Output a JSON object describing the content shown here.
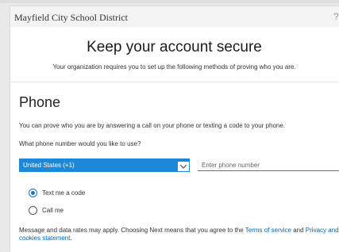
{
  "header": {
    "org_name": "Mayfield City School District",
    "help": "?"
  },
  "page": {
    "title": "Keep your account secure",
    "subtitle": "Your organization requires you to set up the following methods of proving who you are."
  },
  "method": {
    "title": "Phone",
    "description": "You can prove who you are by answering a call on your phone or texting a code to your phone.",
    "question": "What phone number would you like to use?"
  },
  "form": {
    "country_value": "United States (+1)",
    "phone_placeholder": "Enter phone number",
    "phone_value": "",
    "options": [
      {
        "label": "Text me a code",
        "selected": true
      },
      {
        "label": "Call me",
        "selected": false
      }
    ]
  },
  "disclaimer": {
    "text_before": "Message and data rates may apply. Choosing Next means that you agree to the ",
    "terms_link": "Terms of service",
    "and_text": " and ",
    "privacy_link": "Privacy and cookies statement",
    "end": "."
  },
  "colors": {
    "accent": "#1f87d8",
    "link": "#0067b8"
  }
}
